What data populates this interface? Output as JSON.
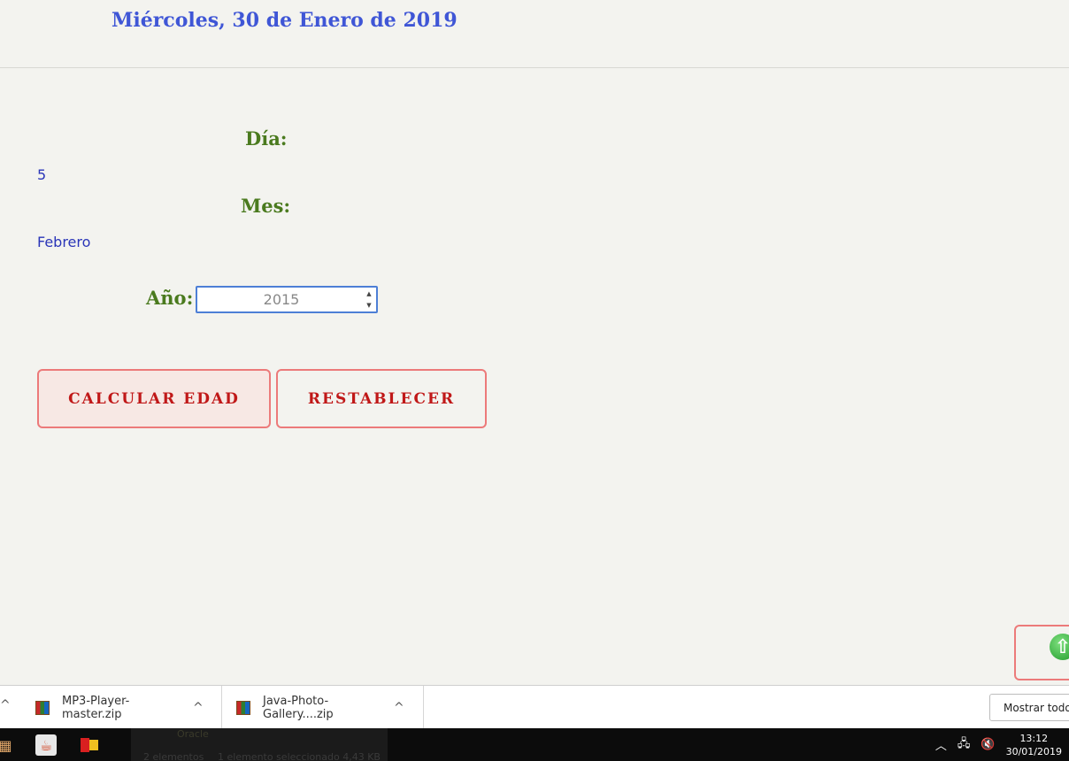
{
  "header": {
    "date": "Miércoles, 30 de Enero de 2019"
  },
  "form": {
    "day_label": "Día:",
    "day_value": "5",
    "month_label": "Mes:",
    "month_value": "Febrero",
    "year_label": "Año:",
    "year_value": "2015"
  },
  "buttons": {
    "calculate": "CALCULAR EDAD",
    "reset": "RESTABLECER"
  },
  "scroll_top": {
    "icon": "arrow-up-circle-icon"
  },
  "downloads": {
    "items": [
      {
        "name": "MP3-Player-master.zip",
        "icon": "zip-archive-icon"
      },
      {
        "name": "Java-Photo-Gallery....zip",
        "icon": "zip-archive-icon"
      }
    ],
    "show_all": "Mostrar todo"
  },
  "taskbar": {
    "explorer_peek": {
      "folder": "Oracle",
      "count": "2 elementos",
      "selection": "1 elemento seleccionado  4,43 KB"
    },
    "clock_time": "13:12",
    "clock_date": "30/01/2019"
  },
  "colors": {
    "header_text": "#3f56d6",
    "label_text": "#4a7a1e",
    "value_text": "#2a35b8",
    "button_text": "#c01818",
    "button_border": "#ec7a7a"
  }
}
